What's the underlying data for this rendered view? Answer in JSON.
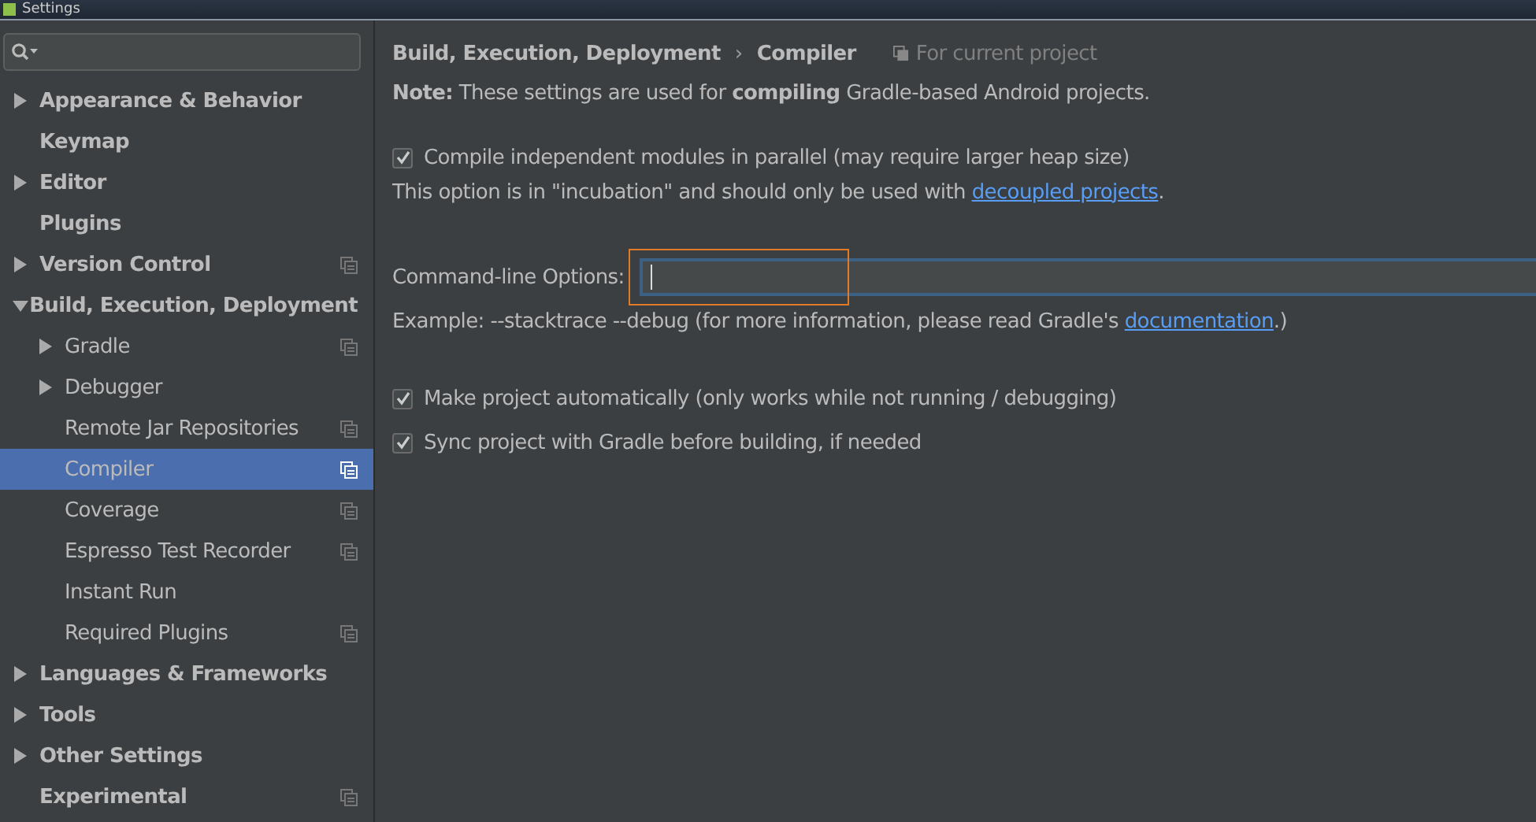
{
  "window": {
    "title": "Settings"
  },
  "sidebar": {
    "items": [
      {
        "label": "Appearance & Behavior",
        "expanded": false,
        "selected": false,
        "project_scoped": false
      },
      {
        "label": "Keymap",
        "selected": false,
        "project_scoped": false
      },
      {
        "label": "Editor",
        "expanded": false,
        "selected": false,
        "project_scoped": false
      },
      {
        "label": "Plugins",
        "selected": false,
        "project_scoped": false
      },
      {
        "label": "Version Control",
        "expanded": false,
        "selected": false,
        "project_scoped": true
      },
      {
        "label": "Build, Execution, Deployment",
        "expanded": true,
        "selected": false,
        "project_scoped": false,
        "children": [
          {
            "label": "Gradle",
            "expanded": false,
            "selected": false,
            "project_scoped": true
          },
          {
            "label": "Debugger",
            "expanded": false,
            "selected": false,
            "project_scoped": false
          },
          {
            "label": "Remote Jar Repositories",
            "selected": false,
            "project_scoped": true
          },
          {
            "label": "Compiler",
            "selected": true,
            "project_scoped": true
          },
          {
            "label": "Coverage",
            "selected": false,
            "project_scoped": true
          },
          {
            "label": "Espresso Test Recorder",
            "selected": false,
            "project_scoped": true
          },
          {
            "label": "Instant Run",
            "selected": false,
            "project_scoped": false
          },
          {
            "label": "Required Plugins",
            "selected": false,
            "project_scoped": true
          }
        ]
      },
      {
        "label": "Languages & Frameworks",
        "expanded": false,
        "selected": false,
        "project_scoped": false
      },
      {
        "label": "Tools",
        "expanded": false,
        "selected": false,
        "project_scoped": false
      },
      {
        "label": "Other Settings",
        "expanded": false,
        "selected": false,
        "project_scoped": false
      },
      {
        "label": "Experimental",
        "selected": false,
        "project_scoped": true
      }
    ]
  },
  "breadcrumb": [
    "Build, Execution, Deployment",
    "Compiler"
  ],
  "breadcrumb_separator": "›",
  "scope": "For current project",
  "note": "**Note:** These settings are used for **compiling** Gradle-based Android projects.",
  "parallel_option": {
    "label": "Compile independent modules in parallel (may require larger heap size)",
    "checked": true
  },
  "parallel_hint": {
    "text": "This option is in \"incubation\" and should only be used with ",
    "link": "decoupled projects",
    "after": "."
  },
  "command_line": {
    "label": "Command-line Options:"
  },
  "example": {
    "text": "Example: --stacktrace --debug (for more information, please read Gradle's ",
    "link": "documentation",
    "after": ".)"
  },
  "options": [
    {
      "label": "Make project automatically (only works while not running / debugging)",
      "checked": true
    },
    {
      "label": "Sync project with Gradle before building, if needed",
      "checked": true
    }
  ]
}
